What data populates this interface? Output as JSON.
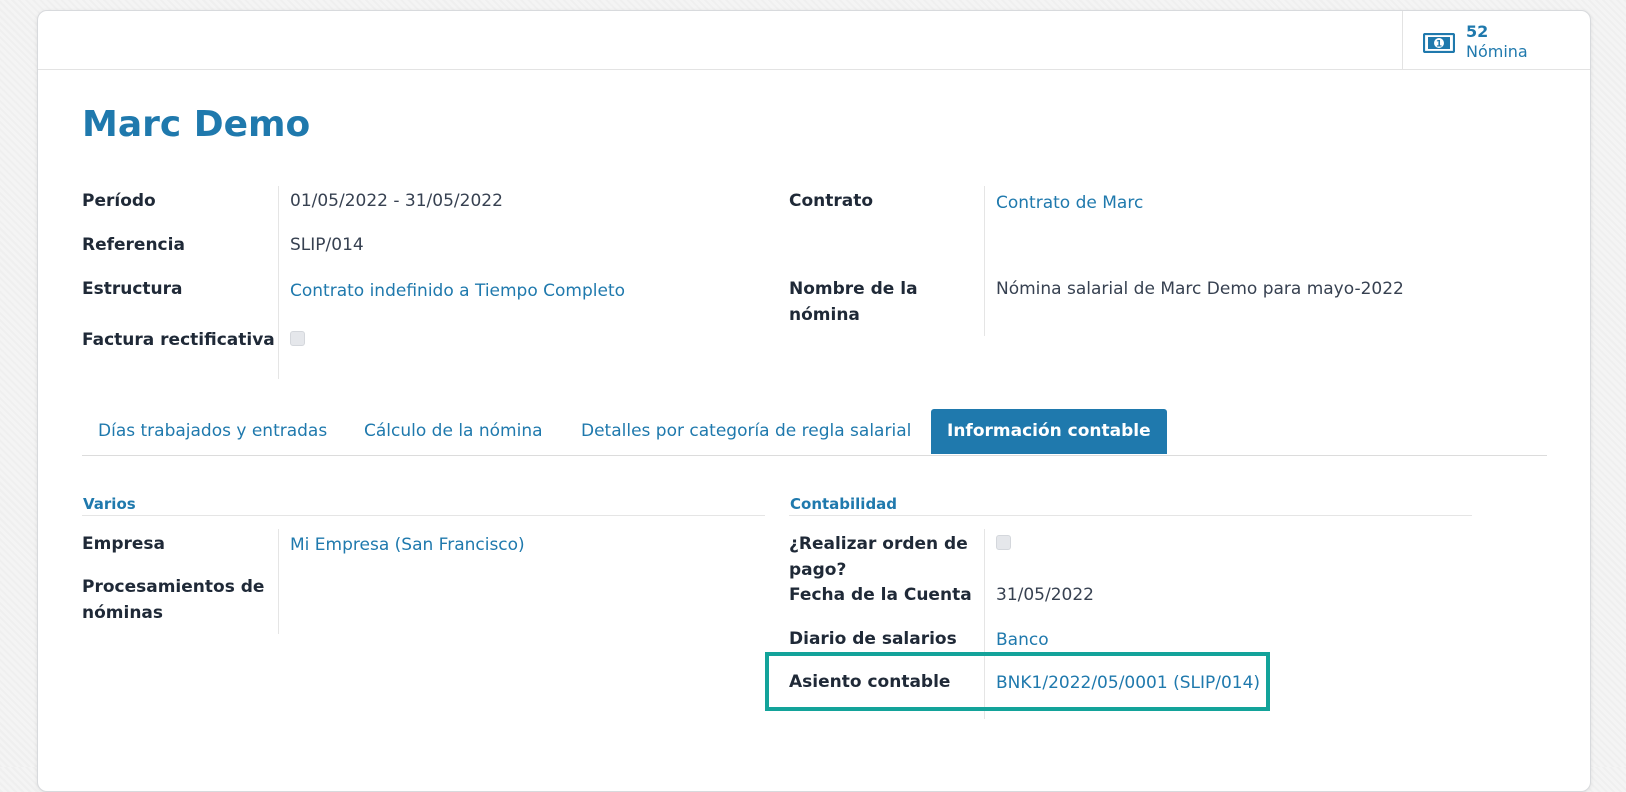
{
  "smart_button": {
    "count": "52",
    "label": "Nómina",
    "icon": "money-icon"
  },
  "title": "Marc Demo",
  "header_left": {
    "periodo_label": "Período",
    "periodo_value": "01/05/2022 - 31/05/2022",
    "referencia_label": "Referencia",
    "referencia_value": "SLIP/014",
    "estructura_label": "Estructura",
    "estructura_value": "Contrato indefinido a Tiempo Completo",
    "factura_label": "Factura rectificativa",
    "factura_checked": false
  },
  "header_right": {
    "contrato_label": "Contrato",
    "contrato_value": "Contrato de Marc",
    "nombre_label_1": "Nombre de la",
    "nombre_label_2": "nómina",
    "nombre_value": "Nómina salarial de Marc Demo para mayo-2022"
  },
  "tabs": [
    {
      "label": "Días trabajados y entradas",
      "active": false
    },
    {
      "label": "Cálculo de la nómina",
      "active": false
    },
    {
      "label": "Detalles por categoría de regla salarial",
      "active": false
    },
    {
      "label": "Información contable",
      "active": true
    }
  ],
  "varios": {
    "title": "Varios",
    "empresa_label": "Empresa",
    "empresa_value": "Mi Empresa (San Francisco)",
    "procesamientos_label_1": "Procesamientos de",
    "procesamientos_label_2": "nóminas"
  },
  "contabilidad": {
    "title": "Contabilidad",
    "orden_label_1": "¿Realizar orden de",
    "orden_label_2": "pago?",
    "orden_checked": false,
    "fecha_label": "Fecha de la Cuenta",
    "fecha_value": "31/05/2022",
    "diario_label": "Diario de salarios",
    "diario_value": "Banco",
    "asiento_label": "Asiento contable",
    "asiento_value": "BNK1/2022/05/0001 (SLIP/014)"
  },
  "colors": {
    "primary": "#1f79ad",
    "highlight": "#13a39a"
  }
}
